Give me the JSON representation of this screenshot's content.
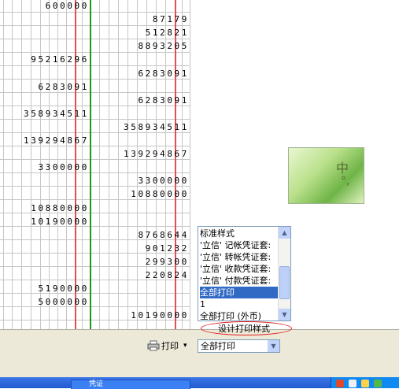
{
  "ledger": {
    "amounts": [
      {
        "text": "600000",
        "column": "debit",
        "row": 0
      },
      {
        "text": "87179",
        "column": "credit",
        "row": 1
      },
      {
        "text": "512821",
        "column": "credit",
        "row": 2
      },
      {
        "text": "8893205",
        "column": "credit",
        "row": 3
      },
      {
        "text": "95216296",
        "column": "debit",
        "row": 4
      },
      {
        "text": "6283091",
        "column": "credit",
        "row": 5
      },
      {
        "text": "6283091",
        "column": "debit",
        "row": 6
      },
      {
        "text": "6283091",
        "column": "credit",
        "row": 7
      },
      {
        "text": "358934511",
        "column": "debit",
        "row": 8
      },
      {
        "text": "358934511",
        "column": "credit",
        "row": 9
      },
      {
        "text": "139294867",
        "column": "debit",
        "row": 10
      },
      {
        "text": "139294867",
        "column": "credit",
        "row": 11
      },
      {
        "text": "3300000",
        "column": "debit",
        "row": 12
      },
      {
        "text": "3300000",
        "column": "credit",
        "row": 13
      },
      {
        "text": "10880000",
        "column": "credit",
        "row": 14
      },
      {
        "text": "10880000",
        "column": "debit",
        "row": 15
      },
      {
        "text": "10190000",
        "column": "debit",
        "row": 16
      },
      {
        "text": "8768644",
        "column": "credit",
        "row": 17
      },
      {
        "text": "901232",
        "column": "credit",
        "row": 18
      },
      {
        "text": "299300",
        "column": "credit",
        "row": 19
      },
      {
        "text": "220824",
        "column": "credit",
        "row": 20
      },
      {
        "text": "5190000",
        "column": "debit",
        "row": 21
      },
      {
        "text": "5000000",
        "column": "debit",
        "row": 22
      },
      {
        "text": "10190000",
        "column": "credit",
        "row": 23
      }
    ]
  },
  "ime": {
    "char": "中",
    "punct": "°,"
  },
  "print_style_list": {
    "options": [
      {
        "label": "标准样式",
        "selected": false
      },
      {
        "label": "'立信' 记帐凭证套:",
        "selected": false
      },
      {
        "label": "'立信' 转帐凭证套:",
        "selected": false
      },
      {
        "label": "'立信' 收款凭证套:",
        "selected": false
      },
      {
        "label": "'立信' 付款凭证套:",
        "selected": false
      },
      {
        "label": "全部打印",
        "selected": true
      },
      {
        "label": "1",
        "selected": false
      },
      {
        "label": "全部打印 (外币)",
        "selected": false
      }
    ]
  },
  "design_print_style": {
    "label": "设计打印样式"
  },
  "toolbar": {
    "print_label": "打印",
    "print_arrow": "▾",
    "range_value": "全部打印"
  },
  "taskbar": {
    "task_label": "凭证"
  },
  "colors": {
    "red_rule": "#e05050",
    "green_rule": "#1a9a1a",
    "grid": "#c6c6c6",
    "selection": "#316ac5",
    "annotation": "#e02020"
  }
}
